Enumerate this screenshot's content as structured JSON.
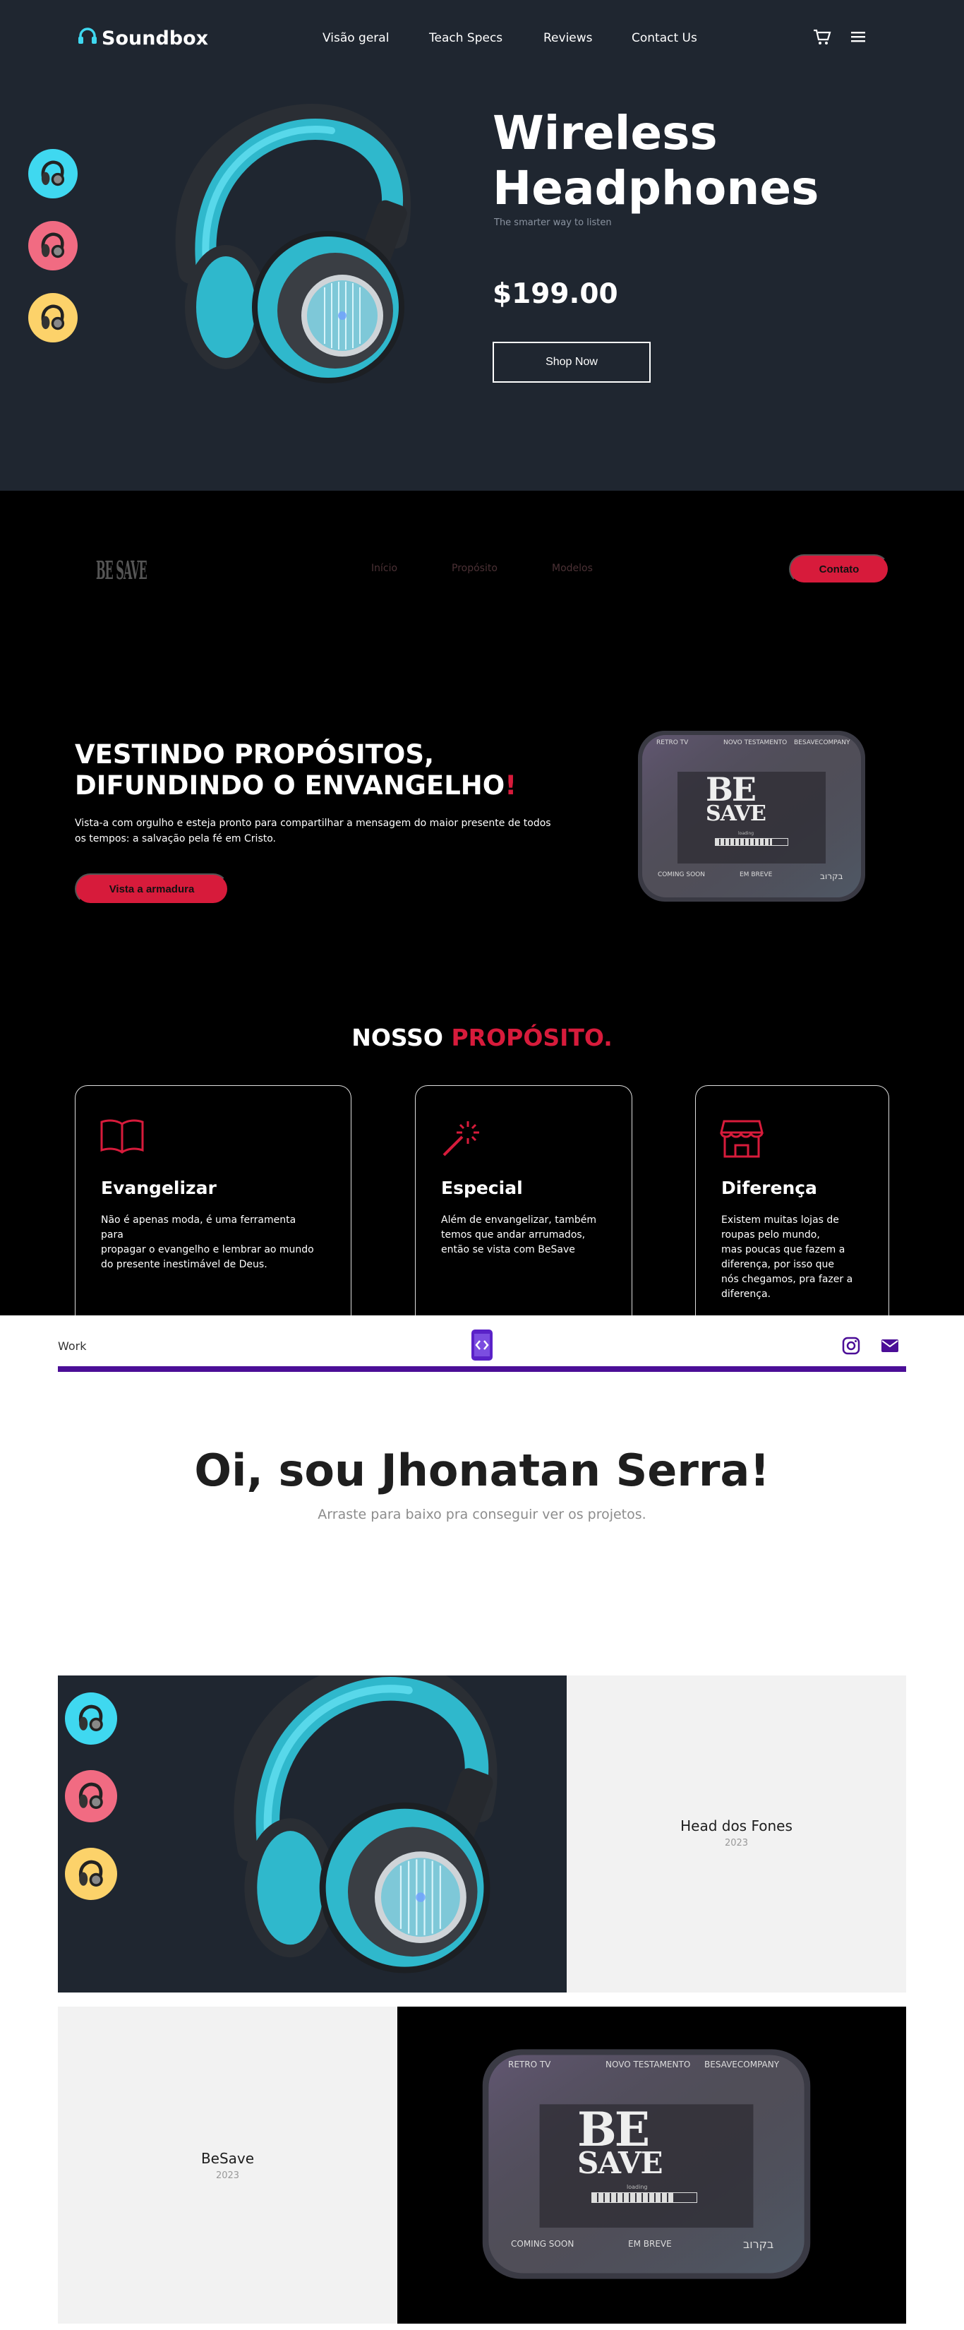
{
  "soundbox": {
    "logo": "Soundbox",
    "nav": [
      "Visão geral",
      "Teach Specs",
      "Reviews",
      "Contact Us"
    ],
    "title_line1": "Wireless",
    "title_line2": "Headphones",
    "tagline": "The smarter way to listen",
    "price": "$199.00",
    "shop_label": "Shop Now",
    "swatch_colors": [
      "#3fd8f0",
      "#f16b82",
      "#fcd26a"
    ],
    "icons": [
      "headphones-icon",
      "cart-icon",
      "menu-icon"
    ]
  },
  "besave": {
    "logo": "BE SAVE",
    "nav": [
      "Início",
      "Propósito",
      "Modelos"
    ],
    "contact_label": "Contato",
    "hero_line1": "VESTINDO PROPÓSITOS,",
    "hero_line2": "DIFUNDINDO O ENVANGELHO",
    "hero_bang": "!",
    "hero_text": "Vista-a com orgulho e esteja pronto para compartilhar a mensagem do maior presente de todos os tempos: a salvação pela fé em Cristo.",
    "armor_label": "Vista a armadura",
    "tv": {
      "top_left": "RETRO TV",
      "top_mid": "NOVO TESTAMENTO",
      "top_right": "BESAVECOMPANY",
      "brand_be": "BE",
      "brand_save": "SAVE",
      "loading": "loading",
      "bottom_left": "COMING SOON",
      "bottom_mid": "EM BREVE",
      "bottom_right": "בקרוב"
    },
    "purpose_title_white": "NOSSO",
    "purpose_title_red": "PROPÓSITO.",
    "accent": "#d71b3b",
    "cards": [
      {
        "title": "Evangelizar",
        "text": "Não é apenas moda, é uma ferramenta\npara\npropagar o evangelho e lembrar ao mundo\ndo presente inestimável de Deus.",
        "icon": "book-icon"
      },
      {
        "title": "Especial",
        "text": "Além de envangelizar, também\ntemos que andar arrumados,\nentão se vista com BeSave",
        "icon": "magic-wand-icon"
      },
      {
        "title": "Diferença",
        "text": "Existem muitas lojas de\nroupas pelo mundo,\nmas poucas que fazem a\ndiferença, por isso que\nnós chegamos, pra fazer a\ndiferença.",
        "icon": "store-icon"
      }
    ]
  },
  "portfolio": {
    "nav_label": "Work",
    "title": "Oi, sou Jhonatan Serra!",
    "subtitle": "Arraste para baixo pra conseguir ver os projetos.",
    "accent": "#4b0e97",
    "icons": [
      "code-phone-icon",
      "instagram-icon",
      "mail-icon"
    ],
    "projects": [
      {
        "name": "Head dos Fones",
        "year": "2023"
      },
      {
        "name": "BeSave",
        "year": "2023"
      }
    ]
  }
}
